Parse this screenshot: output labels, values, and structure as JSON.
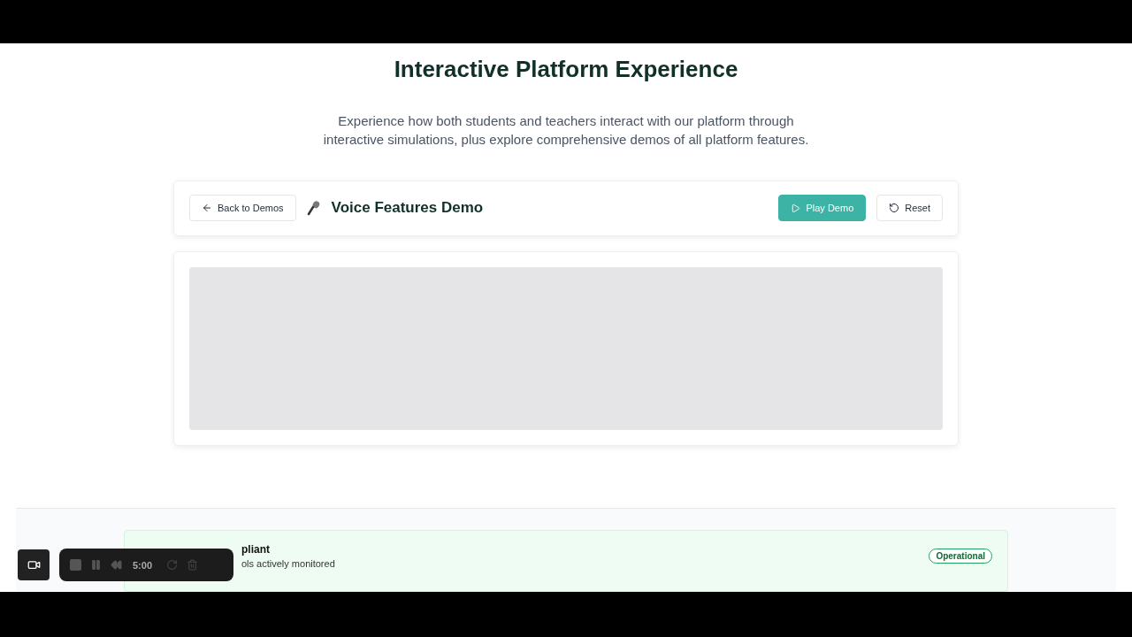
{
  "heading": "Interactive Platform Experience",
  "intro": "Experience how both students and teachers interact with our platform through interactive simulations, plus explore comprehensive demos of all platform features.",
  "demo_header": {
    "back_button": "Back to Demos",
    "title": "Voice Features Demo",
    "play_button": "Play Demo",
    "reset_button": "Reset"
  },
  "status_card": {
    "title": "pliant",
    "subtitle": "ols actively monitored",
    "badge": "Operational"
  },
  "recorder": {
    "time": "5:00"
  }
}
